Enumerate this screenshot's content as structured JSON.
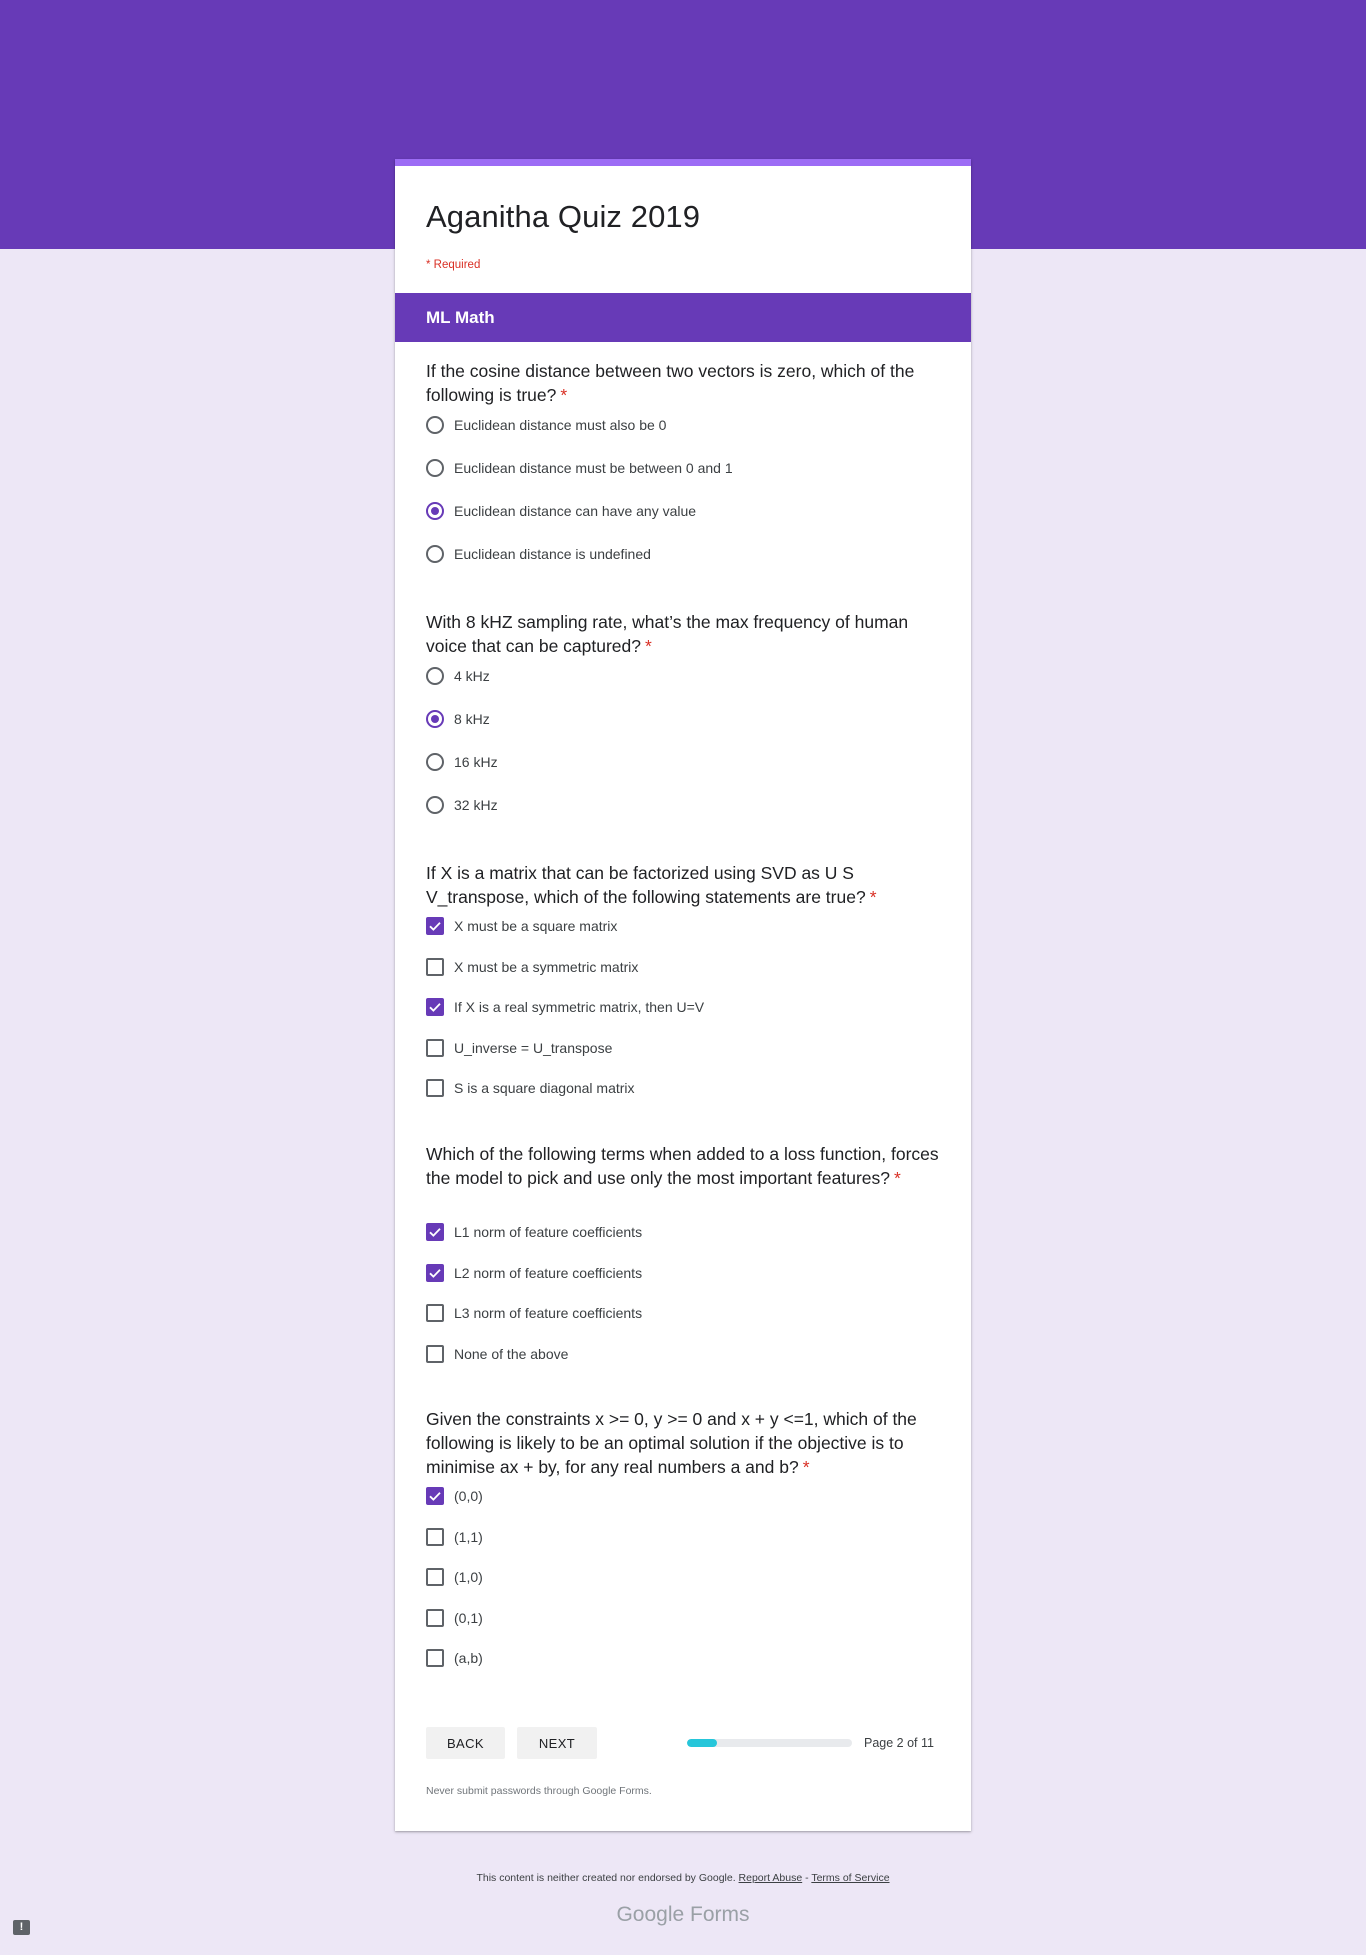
{
  "form": {
    "title": "Aganitha Quiz 2019",
    "required_note": "* Required",
    "section_title": "ML Math"
  },
  "questions": [
    {
      "type": "radio",
      "title": "If the cosine distance between two vectors is zero, which of the following is true?",
      "required_mark": "*",
      "options": [
        {
          "label": "Euclidean distance must also be 0",
          "selected": false
        },
        {
          "label": "Euclidean distance must be between 0 and 1",
          "selected": false
        },
        {
          "label": "Euclidean distance can have any value",
          "selected": true
        },
        {
          "label": "Euclidean distance is undefined",
          "selected": false
        }
      ]
    },
    {
      "type": "radio",
      "title": "With 8 kHZ sampling rate, what’s the max frequency of human voice that can be captured?",
      "required_mark": "*",
      "options": [
        {
          "label": "4 kHz",
          "selected": false
        },
        {
          "label": "8 kHz",
          "selected": true
        },
        {
          "label": "16 kHz",
          "selected": false
        },
        {
          "label": "32 kHz",
          "selected": false
        }
      ]
    },
    {
      "type": "checkbox",
      "title": "If X is a matrix that can be factorized using SVD as U S V_transpose, which of the following statements are true?",
      "required_mark": "*",
      "options": [
        {
          "label": "X must be a square matrix",
          "selected": true
        },
        {
          "label": "X must be a symmetric matrix",
          "selected": false
        },
        {
          "label": "If X is a real symmetric matrix, then U=V",
          "selected": true
        },
        {
          "label": "U_inverse = U_transpose",
          "selected": false
        },
        {
          "label": "S is a square diagonal matrix",
          "selected": false
        }
      ]
    },
    {
      "type": "checkbox",
      "title": "Which of the following terms when added to a loss function, forces the model to pick and use only the most important features?",
      "required_mark": "*",
      "options": [
        {
          "label": "L1 norm of feature coefficients",
          "selected": true
        },
        {
          "label": "L2 norm of feature coefficients",
          "selected": true
        },
        {
          "label": "L3 norm of feature coefficients",
          "selected": false
        },
        {
          "label": "None of the above",
          "selected": false
        }
      ]
    },
    {
      "type": "checkbox",
      "title": "Given the constraints x >= 0, y >= 0 and x + y <=1, which of the following is likely to be an optimal solution if the objective is to minimise ax + by, for any real numbers a and b?",
      "required_mark": "*",
      "options": [
        {
          "label": "(0,0)",
          "selected": true
        },
        {
          "label": "(1,1)",
          "selected": false
        },
        {
          "label": "(1,0)",
          "selected": false
        },
        {
          "label": "(0,1)",
          "selected": false
        },
        {
          "label": "(a,b)",
          "selected": false
        }
      ]
    }
  ],
  "navigation": {
    "back_label": "BACK",
    "next_label": "NEXT",
    "page_indicator": "Page 2 of 11",
    "progress_fraction": 0.18
  },
  "footer": {
    "password_note": "Never submit passwords through Google Forms.",
    "disclaimer": "This content is neither created nor endorsed by Google.",
    "report_abuse": "Report Abuse",
    "separator": "-",
    "terms": "Terms of Service",
    "brand_google": "Google",
    "brand_forms": "Forms"
  },
  "icons": {
    "feedback": "report-icon",
    "checkmark": "check-icon"
  },
  "colors": {
    "accent": "#673ab7",
    "background": "#ede7f6",
    "progress": "#26c6da",
    "required": "#d93025"
  }
}
